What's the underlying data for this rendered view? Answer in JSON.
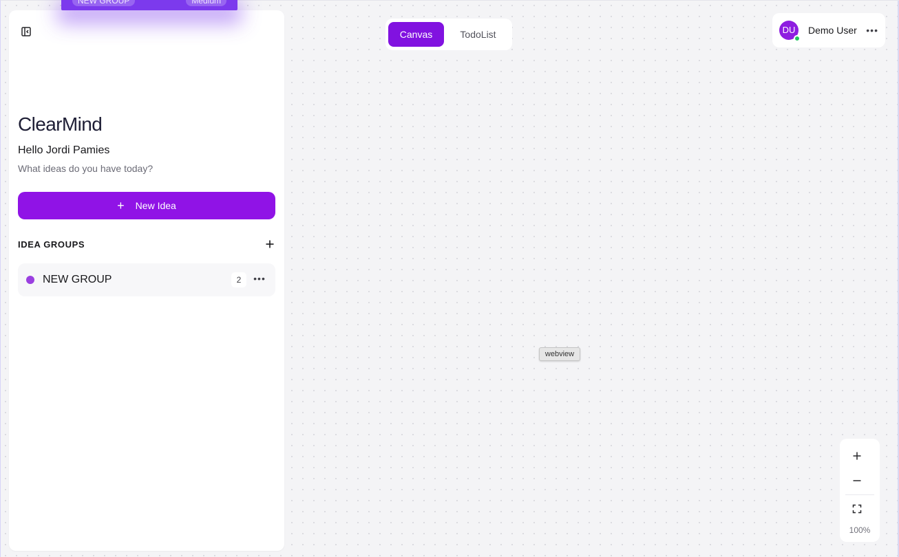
{
  "drag_ghost": {
    "group_label": "NEW GROUP",
    "priority_label": "Medium"
  },
  "sidebar": {
    "collapse_icon": "sidebar-collapse-icon",
    "logo": "ClearMind",
    "greeting": "Hello Jordi Pamies",
    "subtitle": "What ideas do you have today?",
    "new_idea_label": "New Idea",
    "groups_title": "IDEA GROUPS",
    "groups": [
      {
        "name": "NEW GROUP",
        "count": "2",
        "color": "#9a3fe0"
      }
    ]
  },
  "view_tabs": [
    {
      "label": "Canvas",
      "active": true
    },
    {
      "label": "TodoList",
      "active": false
    }
  ],
  "user": {
    "initials": "DU",
    "name": "Demo User",
    "status_color": "#22c55e"
  },
  "webview_label": "webview",
  "zoom": {
    "level": "100%"
  },
  "colors": {
    "accent": "#9013e6",
    "tab_active": "#8112e0",
    "canvas_bg": "#f4f4f6"
  }
}
